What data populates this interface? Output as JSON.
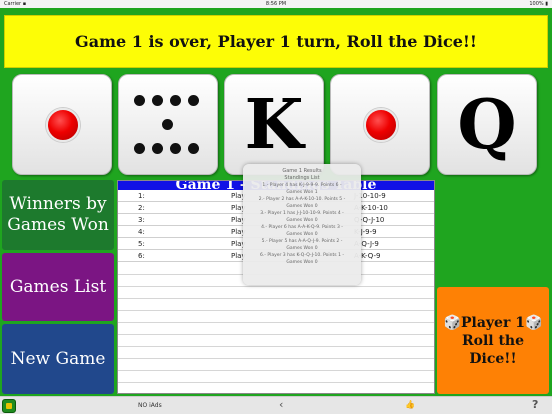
{
  "status_bar": {
    "carrier": "Carrier ▪",
    "time": "8:56 PM",
    "battery": "100% ▮"
  },
  "banner": {
    "text": "Game 1 is over, Player 1 turn, Roll the Dice!!"
  },
  "dice": [
    {
      "face": "one"
    },
    {
      "face": "nine-dots"
    },
    {
      "face": "K"
    },
    {
      "face": "one"
    },
    {
      "face": "Q"
    }
  ],
  "side_buttons": {
    "winners": "Winners by Games Won",
    "games_list": "Games List",
    "new_game": "New Game"
  },
  "scoreboard": {
    "header": "Game 1 - Standings Table",
    "rows": [
      {
        "num": "1:",
        "player": "Play",
        "hand": "J-10-10-9"
      },
      {
        "num": "2:",
        "player": "Play",
        "hand": "A-K-10-10"
      },
      {
        "num": "3:",
        "player": "Play",
        "hand": "Q-Q-J-10"
      },
      {
        "num": "4:",
        "player": "Play",
        "hand": "K-J-9-9"
      },
      {
        "num": "5:",
        "player": "Play",
        "hand": "A-Q-J-9"
      },
      {
        "num": "6:",
        "player": "Play",
        "hand": "A-K-Q-9"
      }
    ]
  },
  "popup": {
    "title": "Game 1 Results",
    "subtitle": "Standings List",
    "lines": [
      "1.- Player 4 has K-J-9-9-9. Points 6 -",
      "Games Won 1",
      "2.- Player 2 has A-A-K-10-10. Points 5 -",
      "Games Won 0",
      "3.- Player 1 has J-J-10-10-9. Points 4 -",
      "Games Won 0",
      "4.- Player 6 has A-A-K-Q-9. Points 3 -",
      "Games Won 0",
      "5.- Player 5 has A-A-Q-J-9. Points 2 -",
      "Games Won 0",
      "6.- Player 3 has K-Q-Q-J-10. Points 1 -",
      "Games Won 0"
    ]
  },
  "roll_button": {
    "line1": "🎲Player 1🎲",
    "line2": "Roll the Dice!!"
  },
  "bottom_bar": {
    "ads_label": "NO iAds",
    "share_glyph": "‹",
    "thumb_glyph": "👍",
    "help_glyph": "?"
  },
  "colors": {
    "background": "#1fa51f",
    "banner": "#fdfd06",
    "winners": "#1d7a2d",
    "games_list": "#7b1583",
    "new_game": "#21488c",
    "roll": "#fe8105",
    "table_header": "#1010e6",
    "pip": "#ee0000"
  }
}
